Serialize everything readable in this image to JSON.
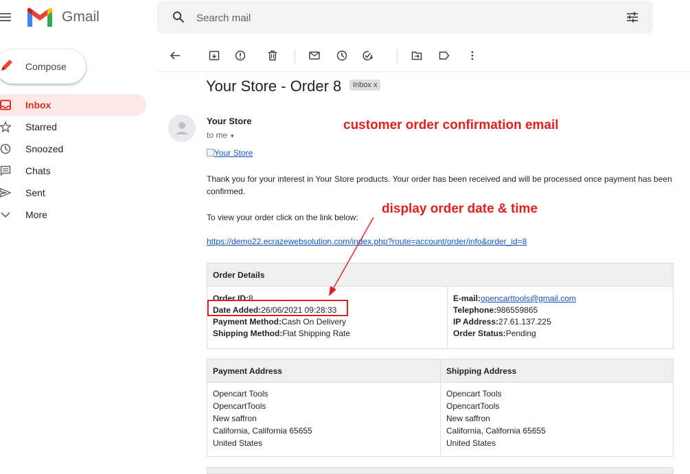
{
  "app": {
    "name": "Gmail"
  },
  "search": {
    "placeholder": "Search mail"
  },
  "compose_label": "Compose",
  "sidebar": {
    "items": [
      {
        "label": "Inbox"
      },
      {
        "label": "Starred"
      },
      {
        "label": "Snoozed"
      },
      {
        "label": "Chats"
      },
      {
        "label": "Sent"
      },
      {
        "label": "More"
      }
    ]
  },
  "email": {
    "subject": "Your Store - Order 8",
    "label_chip": "Inbox",
    "label_chip_close": "x",
    "sender": "Your Store",
    "recipient": "to me",
    "store_image_alt": "Your Store",
    "thanks": "Thank you for your interest in Your Store products. Your order has been received and will be processed once payment has been confirmed.",
    "view_order": "To view your order click on the link below:",
    "order_link": "https://demo22.ecrazewebsolution.com/index.php?route=account/order/info&order_id=8",
    "order_details": {
      "heading": "Order Details",
      "order_id_label": "Order ID:",
      "order_id": "8",
      "date_added_label": "Date Added:",
      "date_added": "26/06/2021 09:28:33",
      "payment_method_label": "Payment Method:",
      "payment_method": "Cash On Delivery",
      "shipping_method_label": "Shipping Method:",
      "shipping_method": "Flat Shipping Rate",
      "email_label": "E-mail:",
      "email": "opencarttools@gmail.com",
      "telephone_label": "Telephone:",
      "telephone": "986559865",
      "ip_label": "IP Address:",
      "ip": "27.61.137.225",
      "status_label": "Order Status:",
      "status": "Pending"
    },
    "payment_address": {
      "heading": "Payment Address",
      "lines": [
        "Opencart Tools",
        "OpencartTools",
        "New saffron",
        "California, California 65655",
        "United States"
      ]
    },
    "shipping_address": {
      "heading": "Shipping Address",
      "lines": [
        "Opencart Tools",
        "OpencartTools",
        "New saffron",
        "California, California 65655",
        "United States"
      ]
    }
  },
  "annotations": {
    "note_1": "customer order confirmation email",
    "note_2": "display order date & time"
  },
  "colors": {
    "annotation": "#e02020",
    "inbox_active": "#d93025",
    "link": "#1155cc"
  }
}
